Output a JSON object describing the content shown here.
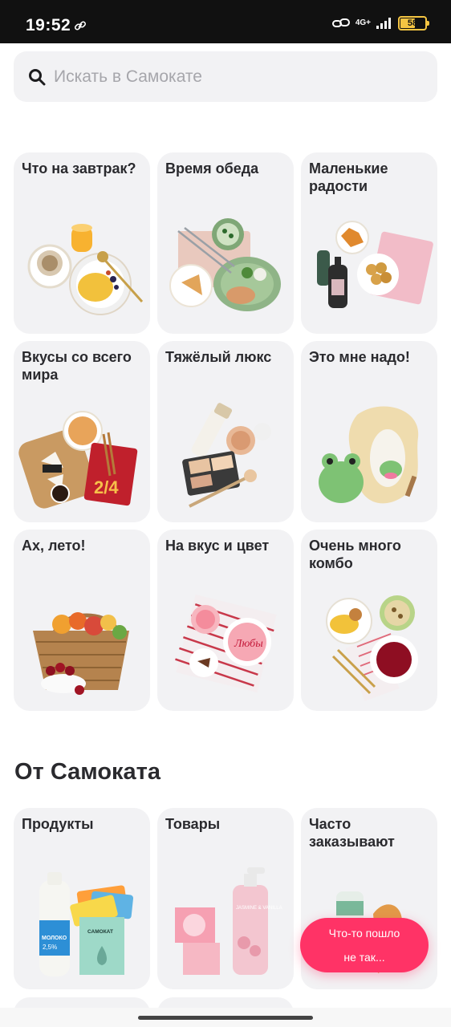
{
  "status_bar": {
    "time": "19:52",
    "network": "4G+",
    "battery": "58"
  },
  "search": {
    "placeholder": "Искать в Самокате"
  },
  "categories": [
    {
      "label": "Что на завтрак?"
    },
    {
      "label": "Время обеда"
    },
    {
      "label": "Маленькие радости"
    },
    {
      "label": "Вкусы со всего мира"
    },
    {
      "label": "Тяжёлый люкс"
    },
    {
      "label": "Это мне надо!"
    },
    {
      "label": "Ах, лето!"
    },
    {
      "label": "На вкус и цвет"
    },
    {
      "label": "Очень много комбо"
    }
  ],
  "from_samokat": {
    "title": "От Самоката",
    "tiles": [
      {
        "label": "Продукты"
      },
      {
        "label": "Товары"
      },
      {
        "label": "Часто заказывают"
      }
    ],
    "milk_label": "МОЛОКО",
    "milk_fat": "2,5%",
    "box_brand": "САМОКАТ",
    "soap_label": "JASMINE & VANILLA"
  },
  "toast": {
    "line1": "Что-то пошло",
    "line2": "не так..."
  },
  "colors": {
    "tile_bg": "#f2f2f4",
    "accent": "#ff3366",
    "status_bar_bg": "#111111"
  },
  "icons": {
    "search": "search-icon",
    "link": "link-icon",
    "hotspot": "hotspot-icon",
    "signal": "signal-icon",
    "battery": "battery-icon"
  }
}
